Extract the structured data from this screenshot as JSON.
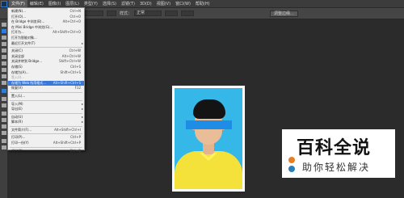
{
  "menubar": {
    "items": [
      "文件(F)",
      "编辑(E)",
      "图像(I)",
      "图层(L)",
      "类型(Y)",
      "选择(S)",
      "滤镜(T)",
      "3D(D)",
      "视图(V)",
      "窗口(W)",
      "帮助(H)"
    ]
  },
  "optionsbar": {
    "label": "样式：",
    "style_value": "正常",
    "button": "调整边缘..."
  },
  "file_menu": {
    "items": [
      {
        "label": "新建(N)...",
        "shortcut": "Ctrl+N"
      },
      {
        "label": "打开(O)...",
        "shortcut": "Ctrl+O"
      },
      {
        "label": "在 Bridge 中浏览(B)...",
        "shortcut": "Alt+Ctrl+O"
      },
      {
        "label": "在 Mini Bridge 中浏览(G)...",
        "shortcut": ""
      },
      {
        "label": "打开为...",
        "shortcut": "Alt+Shift+Ctrl+O"
      },
      {
        "label": "打开为智能对象...",
        "shortcut": ""
      },
      {
        "label": "最近打开文件(T)",
        "shortcut": ""
      },
      {
        "label": "关闭(C)",
        "shortcut": "Ctrl+W"
      },
      {
        "label": "关闭全部",
        "shortcut": "Alt+Ctrl+W"
      },
      {
        "label": "关闭并转到 Bridge...",
        "shortcut": "Shift+Ctrl+W"
      },
      {
        "label": "存储(S)",
        "shortcut": "Ctrl+S"
      },
      {
        "label": "存储为(A)...",
        "shortcut": "Shift+Ctrl+S"
      },
      {
        "label": "签入(I)...",
        "shortcut": ""
      },
      {
        "label": "存储为 Web 所用格式...",
        "shortcut": "Alt+Shift+Ctrl+S"
      },
      {
        "label": "恢复(V)",
        "shortcut": "F12"
      },
      {
        "label": "置入(L)...",
        "shortcut": ""
      },
      {
        "label": "导入(M)",
        "shortcut": ""
      },
      {
        "label": "导出(E)",
        "shortcut": ""
      },
      {
        "label": "自动(U)",
        "shortcut": ""
      },
      {
        "label": "脚本(R)",
        "shortcut": ""
      },
      {
        "label": "文件简介(F)...",
        "shortcut": "Alt+Shift+Ctrl+I"
      },
      {
        "label": "打印(P)...",
        "shortcut": "Ctrl+P"
      },
      {
        "label": "打印一份(Y)",
        "shortcut": "Alt+Shift+Ctrl+P"
      },
      {
        "label": "退出(X)",
        "shortcut": "Ctrl+Q"
      }
    ]
  },
  "watermark": {
    "title": "百科全说",
    "subtitle": "助你轻松解决"
  },
  "colors": {
    "highlight": "#3a79d8",
    "photo_bg": "#35b8e8",
    "shirt": "#f4e23a"
  }
}
